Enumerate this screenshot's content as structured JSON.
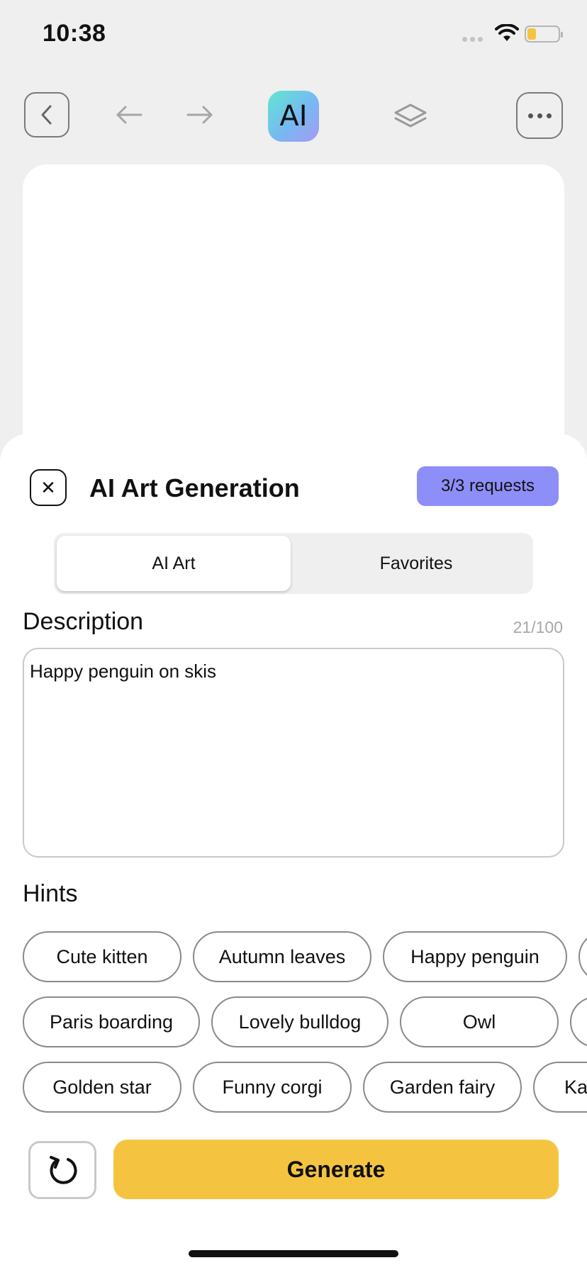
{
  "status_bar": {
    "time": "10:38"
  },
  "toolbar": {
    "ai_label": "AI"
  },
  "panel": {
    "title": "AI Art Generation",
    "requests_badge": "3/3 requests",
    "tabs": [
      {
        "label": "AI Art",
        "active": true
      },
      {
        "label": "Favorites",
        "active": false
      }
    ],
    "description": {
      "label": "Description",
      "char_count": "21/100",
      "value": "Happy penguin on skis"
    },
    "hints": {
      "label": "Hints",
      "rows": [
        [
          "Cute kitten",
          "Autumn leaves",
          "Happy penguin",
          ""
        ],
        [
          "Paris boarding",
          "Lovely bulldog",
          "Owl",
          ""
        ],
        [
          "Golden star",
          "Funny corgi",
          "Garden fairy",
          "Ka"
        ]
      ]
    },
    "generate_label": "Generate"
  },
  "colors": {
    "accent_yellow": "#f4c441",
    "badge_purple": "#8e8ef9",
    "background": "#efefef"
  },
  "icons": [
    "back-icon",
    "undo-icon",
    "redo-icon",
    "layers-icon",
    "more-icon",
    "close-icon",
    "refresh-icon",
    "wifi-icon",
    "battery-icon"
  ]
}
